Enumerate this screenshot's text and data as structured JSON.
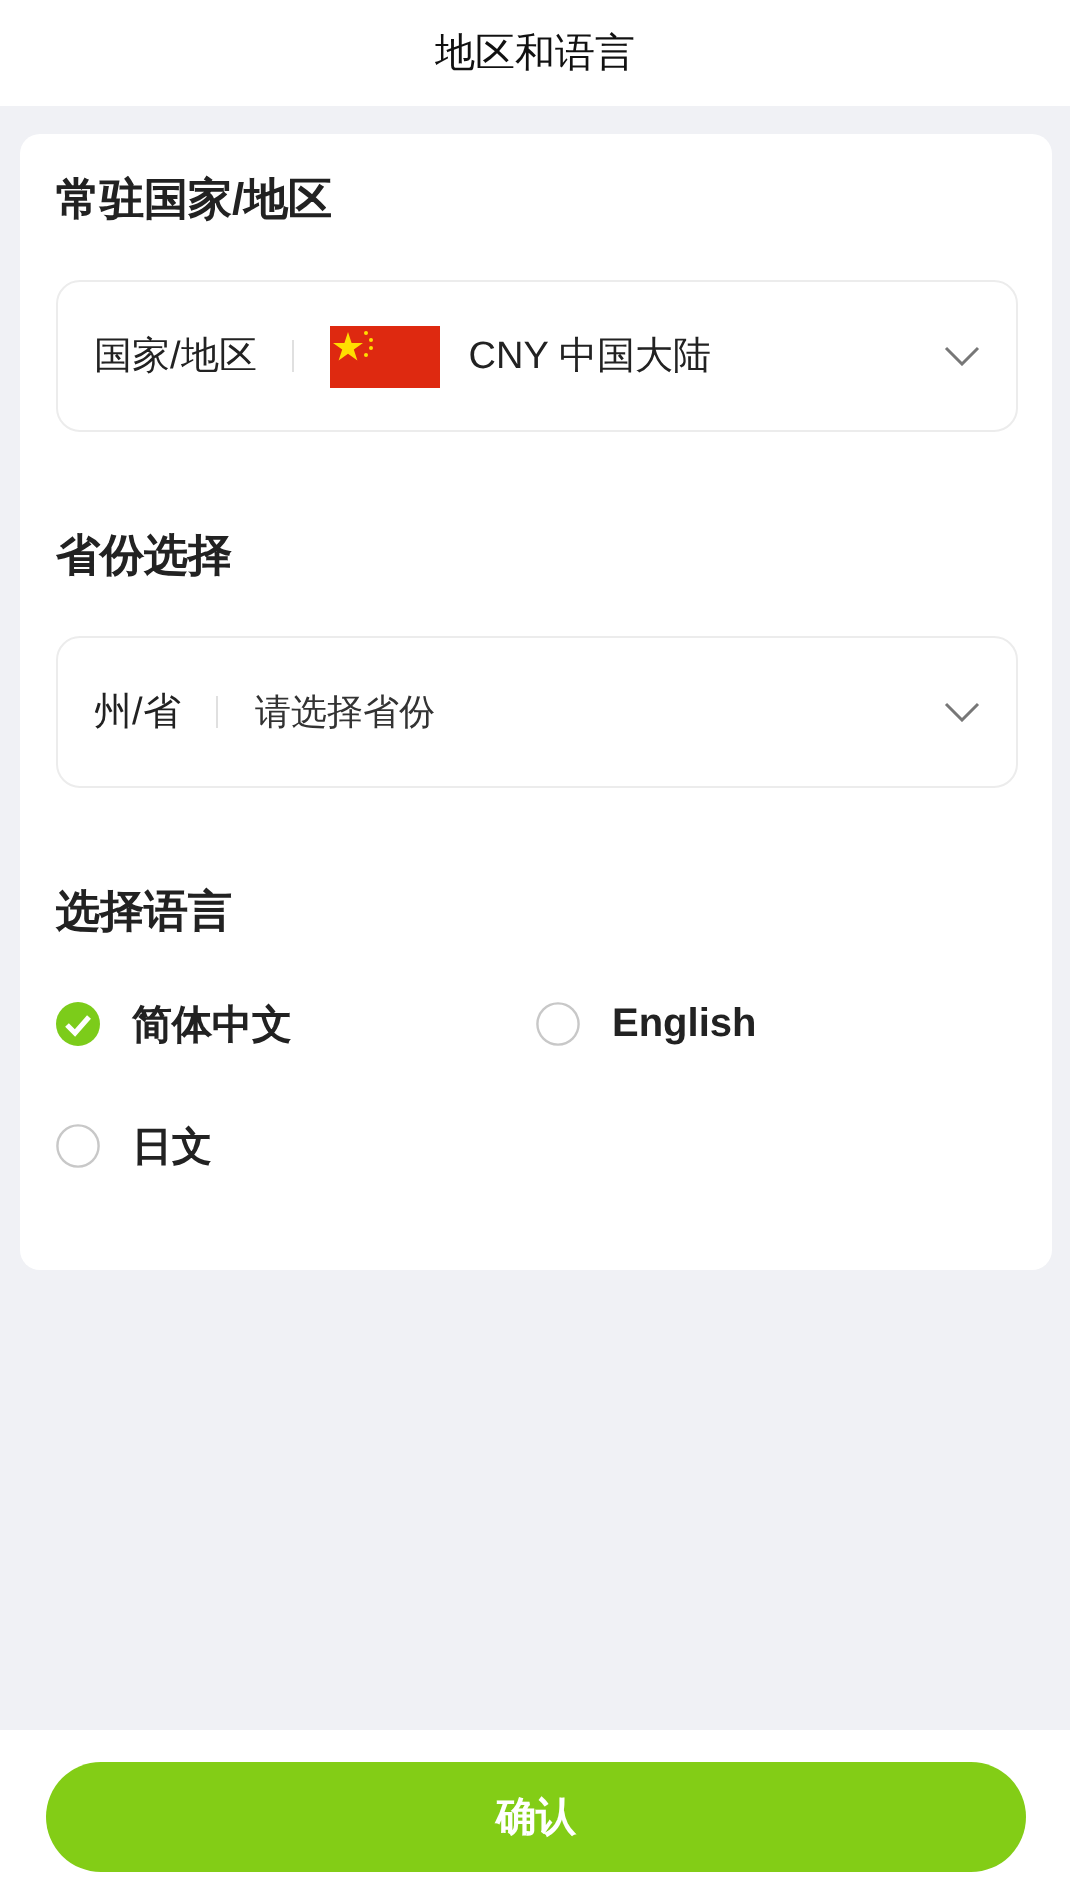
{
  "header": {
    "title": "地区和语言"
  },
  "sections": [
    {
      "kind": "select",
      "title": "常驻国家/地区",
      "field": {
        "label": "国家/地区",
        "flag": true,
        "value": "CNY 中国大陆"
      }
    },
    {
      "kind": "select",
      "title": "省份选择",
      "field": {
        "label": "州/省",
        "placeholder": "请选择省份"
      }
    },
    {
      "kind": "languages",
      "title": "选择语言",
      "languages": [
        {
          "label": "简体中文",
          "selected": true
        },
        {
          "label": "English",
          "selected": false
        },
        {
          "label": "日文",
          "selected": false
        }
      ]
    }
  ],
  "confirm_button": "确认"
}
